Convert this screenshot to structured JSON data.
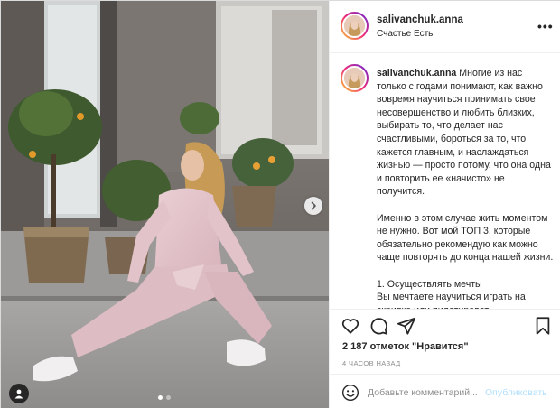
{
  "post": {
    "username": "salivanchuk.anna",
    "location": "Счастье Есть",
    "more_icon": "more-options-icon",
    "caption": {
      "username": "salivanchuk.anna",
      "paragraph1": "Многие из нас только с годами понимают, как важно вовремя научиться принимать свое несовершенство и любить близких, выбирать то, что делает нас счастливыми, бороться за то, что кажется главным, и наслаждаться жизнью — просто потому, что она одна и повторить ее «начисто» не получится.",
      "paragraph2": "Именно в этом случае жить моментом не нужно. Вот мой ТОП 3, которые обязательно рекомендую как можно чаще повторять до конца нашей жизни.",
      "paragraph3_line1": "1. Осуществлять мечты",
      "paragraph3_line2": "Вы мечтаете научиться играть на скрипке или пилотировать"
    },
    "likes": "2 187 отметок \"Нравится\"",
    "time": "4 ЧАСОВ НАЗАД",
    "comment": {
      "placeholder": "Добавьте комментарий...",
      "publish_label": "Опубликовать"
    },
    "carousel": {
      "current": 1,
      "total": 2
    },
    "icons": [
      "heart-icon",
      "comment-icon",
      "share-icon",
      "bookmark-icon",
      "emoji-icon",
      "chevron-right-icon",
      "user-tag-icon"
    ],
    "colors": {
      "link_disabled": "#b2dffc",
      "text": "#262626",
      "muted": "#8e8e8e",
      "border": "#efefef"
    }
  }
}
